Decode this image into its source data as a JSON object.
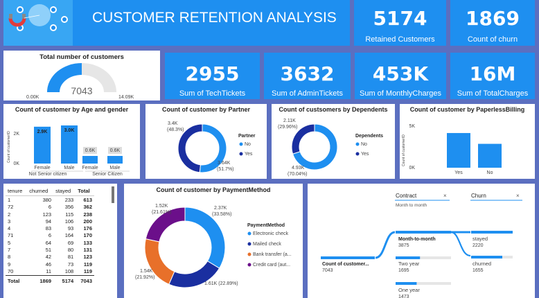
{
  "header": {
    "title": "CUSTOMER RETENTION ANALYSIS"
  },
  "colors": {
    "blue": "#1e8ff0",
    "navy": "#1a2fa0",
    "orange": "#e8702a",
    "purple": "#6b0f8a"
  },
  "kpis_top": [
    {
      "value": "5174",
      "label": "Retained Customers"
    },
    {
      "value": "1869",
      "label": "Count of churn"
    }
  ],
  "kpis_mid": [
    {
      "value": "2955",
      "label": "Sum of TechTickets"
    },
    {
      "value": "3632",
      "label": "Sum of AdminTickets"
    },
    {
      "value": "453K",
      "label": "Sum of MonthlyCharges"
    },
    {
      "value": "16M",
      "label": "Sum of TotalCharges"
    }
  ],
  "gauge": {
    "title": "Total number of customers",
    "value": "7043",
    "min": "0.00K",
    "max": "14.09K",
    "fraction": 0.5
  },
  "age_gender": {
    "title": "Count of customer by Age and gender",
    "ylabel": "Count of customerID",
    "ticks": [
      "2K",
      "0K"
    ],
    "bars": [
      {
        "label": "Female",
        "value": 2.9,
        "text": "2.9K"
      },
      {
        "label": "Male",
        "value": 3.0,
        "text": "3.0K"
      },
      {
        "label": "Female",
        "value": 0.6,
        "text": "0.6K"
      },
      {
        "label": "Male",
        "value": 0.6,
        "text": "0.6K"
      }
    ],
    "groups": [
      "Not Senior citizen",
      "Senior Citizen"
    ]
  },
  "partner": {
    "title": "Count of customer by Partner",
    "legend_title": "Partner",
    "slices": [
      {
        "label": "No",
        "value": 3.64,
        "text": "3.64K",
        "pct": "(51.7%)"
      },
      {
        "label": "Yes",
        "value": 3.4,
        "text": "3.4K",
        "pct": "(48.3%)"
      }
    ]
  },
  "dependents": {
    "title": "Count of custsomers by Dependents",
    "legend_title": "Dependents",
    "slices": [
      {
        "label": "No",
        "value": 4.93,
        "text": "4.93K",
        "pct": "(70.04%)"
      },
      {
        "label": "Yes",
        "value": 2.11,
        "text": "2.11K",
        "pct": "(29.96%)"
      }
    ]
  },
  "paperless": {
    "title": "Count of customer by PaperlessBilling",
    "ylabel": "Count of customerID",
    "ticks": [
      "5K",
      "0K"
    ],
    "bars": [
      {
        "label": "Yes",
        "value": 4.17
      },
      {
        "label": "No",
        "value": 2.87
      }
    ]
  },
  "tenure_table": {
    "headers": [
      "tenure",
      "churned",
      "stayed",
      "Total"
    ],
    "rows": [
      [
        "1",
        "380",
        "233",
        "613"
      ],
      [
        "72",
        "6",
        "356",
        "362"
      ],
      [
        "2",
        "123",
        "115",
        "238"
      ],
      [
        "3",
        "94",
        "106",
        "200"
      ],
      [
        "4",
        "83",
        "93",
        "176"
      ],
      [
        "71",
        "6",
        "164",
        "170"
      ],
      [
        "5",
        "64",
        "69",
        "133"
      ],
      [
        "7",
        "51",
        "80",
        "131"
      ],
      [
        "8",
        "42",
        "81",
        "123"
      ],
      [
        "9",
        "46",
        "73",
        "119"
      ],
      [
        "70",
        "11",
        "108",
        "119"
      ]
    ],
    "total": [
      "Total",
      "1869",
      "5174",
      "7043"
    ]
  },
  "payment": {
    "title": "Count of customer by PaymentMethod",
    "legend_title": "PaymentMethod",
    "slices": [
      {
        "label": "Electronic check",
        "value": 2.37,
        "text": "2.37K",
        "pct": "(33.58%)"
      },
      {
        "label": "Mailed check",
        "value": 1.61,
        "text": "1.61K (22.89%)",
        "pct": ""
      },
      {
        "label": "Bank transfer (a...",
        "value": 1.54,
        "text": "1.54K",
        "pct": "(21.92%)"
      },
      {
        "label": "Credit card (aut...",
        "value": 1.52,
        "text": "1.52K",
        "pct": "(21.61%)"
      }
    ]
  },
  "decomp": {
    "contract_label": "Contract",
    "contract_value": "Month to month",
    "churn_label": "Churn",
    "root_label": "Count of customer...",
    "root_value": "7043",
    "contract_items": [
      {
        "label": "Month-to-month",
        "value": "3875",
        "fraction": 1.0
      },
      {
        "label": "Two year",
        "value": "1695",
        "fraction": 0.44
      },
      {
        "label": "One year",
        "value": "1473",
        "fraction": 0.38
      }
    ],
    "churn_items": [
      {
        "label": "stayed",
        "value": "2220",
        "fraction": 1.0
      },
      {
        "label": "churned",
        "value": "1655",
        "fraction": 0.75
      }
    ]
  }
}
